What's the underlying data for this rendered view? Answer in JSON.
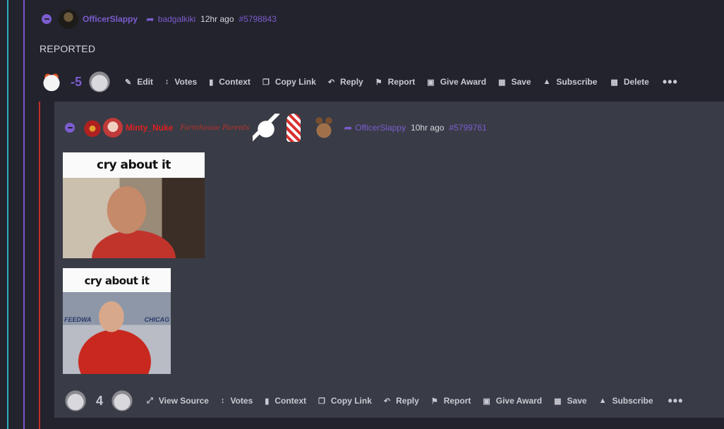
{
  "parent_comment": {
    "username": "OfficerSlappy",
    "reply_to": "badgalkiki",
    "time": "12hr ago",
    "comment_id": "#5798843",
    "body": "REPORTED",
    "score": "-5",
    "actions": {
      "edit": "Edit",
      "votes": "Votes",
      "context": "Context",
      "copy_link": "Copy Link",
      "reply": "Reply",
      "report": "Report",
      "give_award": "Give Award",
      "save": "Save",
      "subscribe": "Subscribe",
      "delete": "Delete",
      "more": "•••"
    }
  },
  "reply_comment": {
    "username": "Minty_Nuke",
    "flair": "Farmhouse Parents",
    "reply_to": "OfficerSlappy",
    "time": "10hr ago",
    "comment_id": "#5799761",
    "images": [
      {
        "caption": "cry about it"
      },
      {
        "caption": "cry about it",
        "banner_left": "FEEDWA",
        "banner_right": "CHICAG"
      }
    ],
    "score": "4",
    "actions": {
      "view_source": "View Source",
      "votes": "Votes",
      "context": "Context",
      "copy_link": "Copy Link",
      "reply": "Reply",
      "report": "Report",
      "give_award": "Give Award",
      "save": "Save",
      "subscribe": "Subscribe",
      "more": "•••"
    }
  },
  "colors": {
    "background": "#22232c",
    "reply_background": "#393c46",
    "accent_purple": "#7c5ccf",
    "negative_score": "#7c5ccf",
    "username_red": "#e02020",
    "thread_teal": "#2fb0bf",
    "thread_red": "#c0302a"
  },
  "icons": {
    "collapse": "minus-circle-icon",
    "reply_to": "share-arrow-icon",
    "edit": "pencil-icon",
    "votes": "up-down-arrows-icon",
    "context": "book-icon",
    "copy_link": "copy-icon",
    "reply": "reply-arrow-icon",
    "report": "flag-icon",
    "give_award": "gift-icon",
    "save": "floppy-disk-icon",
    "subscribe": "bell-icon",
    "delete": "trash-icon",
    "view_source": "expand-arrows-icon",
    "more": "ellipsis-icon"
  }
}
